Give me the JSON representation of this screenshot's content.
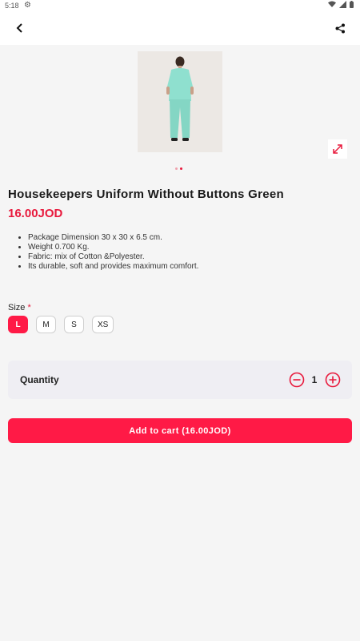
{
  "status_bar": {
    "time": "5:18"
  },
  "product": {
    "title": "Housekeepers Uniform Without Buttons Green",
    "price": "16.00JOD",
    "features": [
      "Package Dimension 30 x 30 x 6.5 cm.",
      "Weight 0.700 Kg.",
      "Fabric: mix of Cotton &Polyester.",
      "Its durable, soft and provides maximum comfort."
    ]
  },
  "gallery": {
    "image_count": 2,
    "active_index": 1
  },
  "size": {
    "label": "Size",
    "required_mark": "*",
    "options": [
      "L",
      "M",
      "S",
      "XS"
    ],
    "selected": "L"
  },
  "quantity": {
    "label": "Quantity",
    "value": "1"
  },
  "cart": {
    "button_label": "Add to cart (16.00JOD)"
  },
  "colors": {
    "accent": "#ff1a46",
    "price": "#e8193c",
    "background": "#f5f5f5",
    "uniform": "#8fe0cf"
  },
  "icons": {
    "back": "chevron-left-icon",
    "share": "share-icon",
    "zoom": "expand-icon",
    "minus": "minus-circle-icon",
    "plus": "plus-circle-icon"
  }
}
